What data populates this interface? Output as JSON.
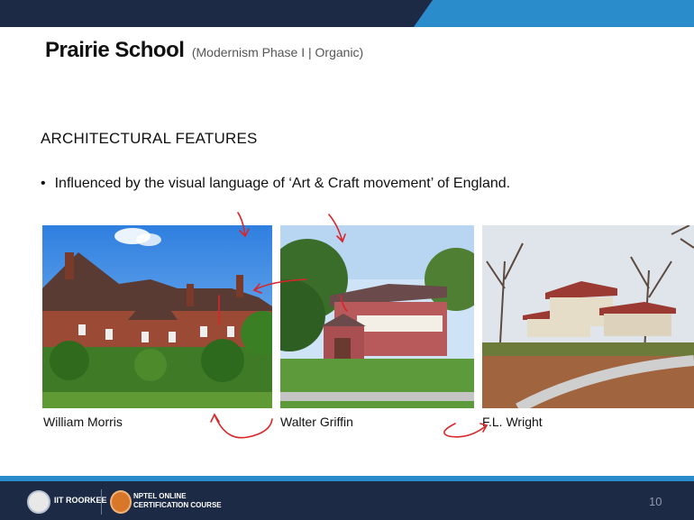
{
  "title": {
    "main": "Prairie School",
    "sub": "(Modernism Phase I | Organic)"
  },
  "heading": "ARCHITECTURAL FEATURES",
  "bullet": "Influenced by the visual language of ‘Art & Craft movement’ of England.",
  "captions": [
    "William Morris",
    "Walter Griffin",
    "F.L. Wright"
  ],
  "footer": {
    "logo1_text": "IIT ROORKEE",
    "logo2_line1": "NPTEL ONLINE",
    "logo2_line2": "CERTIFICATION COURSE",
    "page_number": "10"
  },
  "colors": {
    "header_dark": "#1d2a45",
    "accent_blue": "#2b8ccb",
    "ink_red": "#d8262a"
  }
}
